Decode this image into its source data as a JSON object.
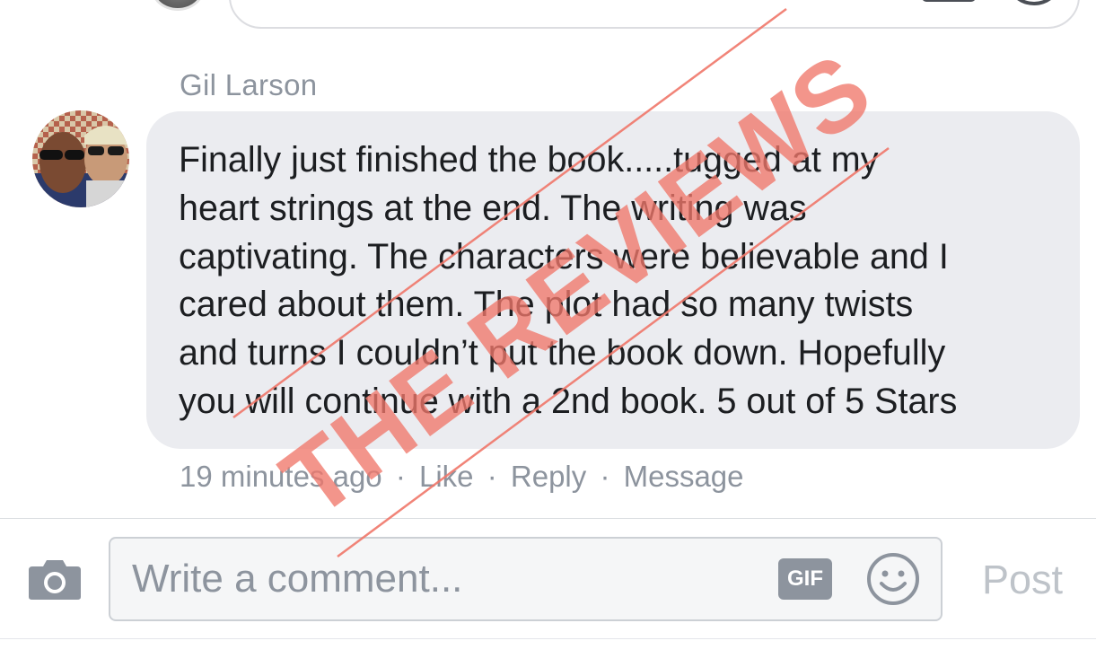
{
  "comment": {
    "author": "Gil Larson",
    "body_lines": [
      "Finally just finished the book.....tugged at my",
      "heart strings at the end. The writing was",
      "captivating. The characters were believable and I",
      "cared about them. The plot had so many twists",
      "and turns I couldn’t put the book down. Hopefully",
      "you will continue with a 2nd book. 5 out of 5 Stars"
    ],
    "timestamp": "19 minutes ago",
    "actions": {
      "like": "Like",
      "reply": "Reply",
      "message": "Message"
    },
    "separator": "·"
  },
  "composer": {
    "placeholder": "Write a comment...",
    "gif_label": "GIF",
    "post_label": "Post",
    "camera_icon": "camera-icon",
    "emoji_icon": "smiley-icon"
  },
  "watermark": {
    "text": "THE REVIEWS",
    "color": "#f0776a"
  },
  "colors": {
    "bubble": "#ebecf0",
    "meta_text": "#8d949e",
    "post_disabled": "#bec3c9"
  }
}
